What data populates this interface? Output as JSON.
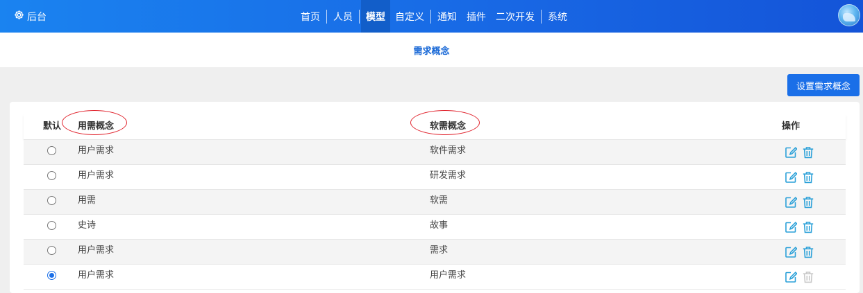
{
  "header": {
    "brand_label": "后台",
    "nav": [
      {
        "label": "首页",
        "active": false
      },
      {
        "label": "人员",
        "active": false
      },
      {
        "label": "模型",
        "active": true
      },
      {
        "label": "自定义",
        "active": false
      },
      {
        "label": "通知",
        "active": false
      },
      {
        "label": "插件",
        "active": false
      },
      {
        "label": "二次开发",
        "active": false
      },
      {
        "label": "系统",
        "active": false
      }
    ]
  },
  "page": {
    "title": "需求概念",
    "set_button_label": "设置需求概念"
  },
  "table": {
    "columns": {
      "default": "默认",
      "user_concept": "用需概念",
      "software_concept": "软需概念",
      "actions": "操作"
    },
    "rows": [
      {
        "user_concept": "用户需求",
        "software_concept": "软件需求",
        "is_default": false,
        "delete_disabled": false
      },
      {
        "user_concept": "用户需求",
        "software_concept": "研发需求",
        "is_default": false,
        "delete_disabled": false
      },
      {
        "user_concept": "用需",
        "software_concept": "软需",
        "is_default": false,
        "delete_disabled": false
      },
      {
        "user_concept": "史诗",
        "software_concept": "故事",
        "is_default": false,
        "delete_disabled": false
      },
      {
        "user_concept": "用户需求",
        "software_concept": "需求",
        "is_default": false,
        "delete_disabled": false
      },
      {
        "user_concept": "用户需求",
        "software_concept": "用户需求",
        "is_default": true,
        "delete_disabled": true
      }
    ]
  },
  "icons": {
    "brand": "gear-icon",
    "edit": "edit-icon",
    "delete": "trash-icon",
    "avatar": "avatar"
  },
  "colors": {
    "header": "#1a83f0",
    "accent": "#1a6fe8",
    "action_icon": "#2aa0d8",
    "action_icon_disabled": "#c8c8c8",
    "annotation_circle": "#e0202a"
  }
}
